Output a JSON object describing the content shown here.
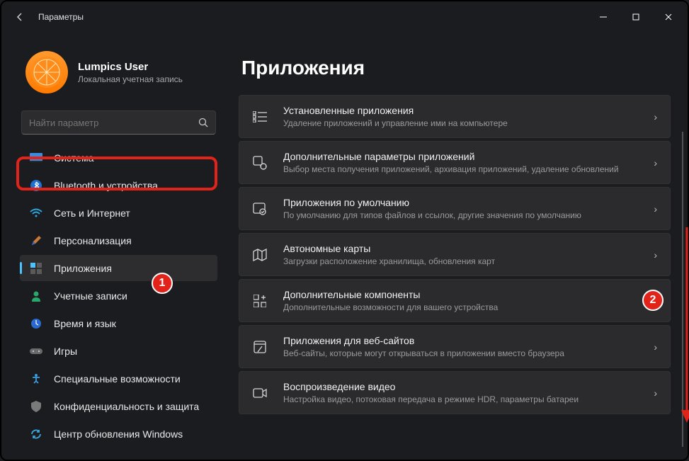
{
  "window": {
    "title": "Параметры"
  },
  "user": {
    "name": "Lumpics User",
    "subtitle": "Локальная учетная запись"
  },
  "search": {
    "placeholder": "Найти параметр"
  },
  "nav": [
    {
      "label": "Система"
    },
    {
      "label": "Bluetooth и устройства"
    },
    {
      "label": "Сеть и Интернет"
    },
    {
      "label": "Персонализация"
    },
    {
      "label": "Приложения"
    },
    {
      "label": "Учетные записи"
    },
    {
      "label": "Время и язык"
    },
    {
      "label": "Игры"
    },
    {
      "label": "Специальные возможности"
    },
    {
      "label": "Конфиденциальность и защита"
    },
    {
      "label": "Центр обновления Windows"
    }
  ],
  "page": {
    "title": "Приложения"
  },
  "cards": [
    {
      "title": "Установленные приложения",
      "sub": "Удаление приложений и управление ими на компьютере"
    },
    {
      "title": "Дополнительные параметры приложений",
      "sub": "Выбор места получения приложений, архивация приложений, удаление обновлений"
    },
    {
      "title": "Приложения по умолчанию",
      "sub": "По умолчанию для типов файлов и ссылок, другие значения по умолчанию"
    },
    {
      "title": "Автономные карты",
      "sub": "Загрузки расположение хранилища, обновления карт"
    },
    {
      "title": "Дополнительные компоненты",
      "sub": "Дополнительные возможности для вашего устройства"
    },
    {
      "title": "Приложения для веб-сайтов",
      "sub": "Веб-сайты, которые могут открываться в приложении вместо браузера"
    },
    {
      "title": "Воспроизведение видео",
      "sub": "Настройка видео, потоковая передача в режиме HDR, параметры батареи"
    }
  ],
  "badges": {
    "one": "1",
    "two": "2"
  }
}
